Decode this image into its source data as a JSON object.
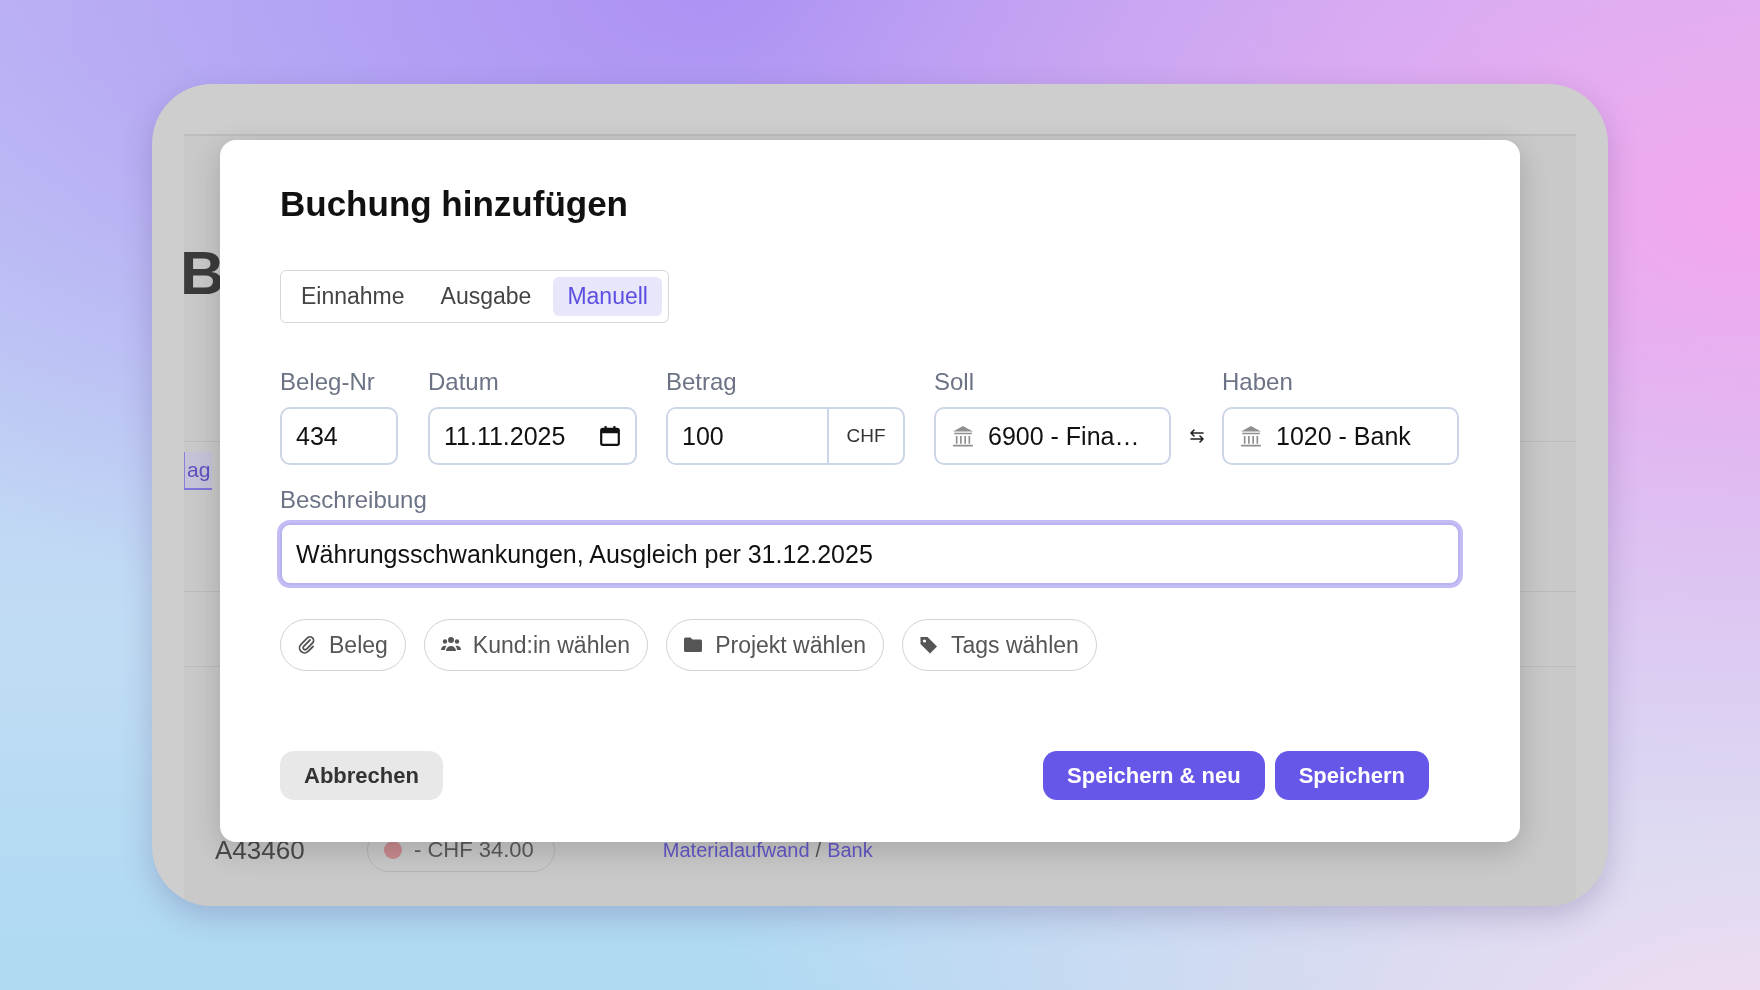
{
  "background_page": {
    "heading_fragment": "B",
    "tab_fragment": "ag",
    "row": {
      "number": "A43460",
      "amount": "- CHF 34.00",
      "color": "#c98a8f",
      "account_from": "Materialaufwand",
      "separator": "/",
      "account_to": "Bank"
    }
  },
  "dialog": {
    "title": "Buchung hinzufügen",
    "modes": [
      {
        "label": "Einnahme",
        "selected": false
      },
      {
        "label": "Ausgabe",
        "selected": false
      },
      {
        "label": "Manuell",
        "selected": true
      }
    ],
    "beleg_nr": {
      "label": "Beleg-Nr",
      "value": "434"
    },
    "datum": {
      "label": "Datum",
      "value": "11.11.2025"
    },
    "betrag": {
      "label": "Betrag",
      "value": "100",
      "currency": "CHF"
    },
    "soll": {
      "label": "Soll",
      "value": "6900 - Fina…"
    },
    "haben": {
      "label": "Haben",
      "value": "1020 - Bank"
    },
    "beschreibung": {
      "label": "Beschreibung",
      "value": "Währungsschwankungen, Ausgleich per 31.12.2025",
      "focused": true
    },
    "attachments": [
      {
        "kind": "paperclip",
        "label": "Beleg"
      },
      {
        "kind": "people",
        "label": "Kund:in wählen"
      },
      {
        "kind": "folder",
        "label": "Projekt wählen"
      },
      {
        "kind": "tag",
        "label": "Tags wählen"
      }
    ],
    "buttons": [
      {
        "kind": "secondary",
        "label": "Abbrechen"
      },
      {
        "kind": "primary",
        "label": "Speichern & neu"
      },
      {
        "kind": "primary",
        "label": "Speichern"
      }
    ]
  }
}
